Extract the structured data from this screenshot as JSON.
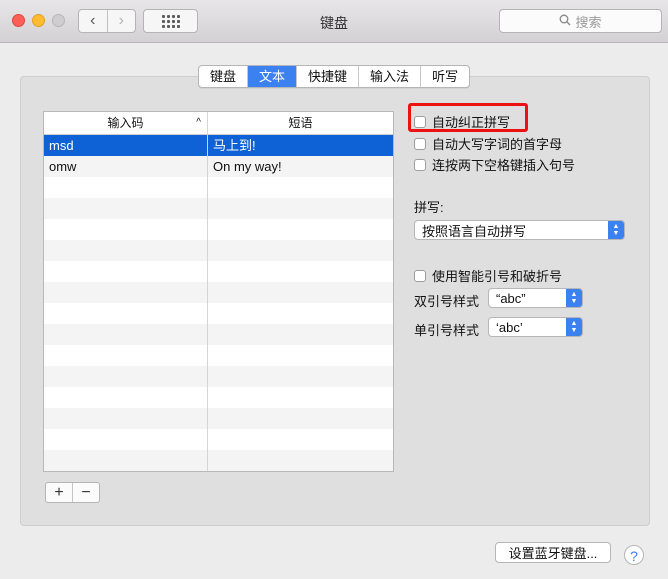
{
  "window": {
    "title": "键盘",
    "search_placeholder": "搜索",
    "nav_back_icon": "chevron-left-icon",
    "nav_forward_icon": "chevron-right-icon"
  },
  "tabs": [
    {
      "label": "键盘",
      "active": false
    },
    {
      "label": "文本",
      "active": true
    },
    {
      "label": "快捷键",
      "active": false
    },
    {
      "label": "输入法",
      "active": false
    },
    {
      "label": "听写",
      "active": false
    }
  ],
  "table": {
    "col1_header": "输入码",
    "col2_header": "短语",
    "sort_indicator": "^",
    "rows": [
      {
        "code": "msd",
        "phrase": "马上到!",
        "selected": true
      },
      {
        "code": "omw",
        "phrase": "On my way!",
        "selected": false
      }
    ],
    "add_label": "+",
    "remove_label": "−"
  },
  "options": {
    "autocorrect": {
      "label": "自动纠正拼写",
      "checked": false
    },
    "capitalize": {
      "label": "自动大写字词的首字母",
      "checked": false
    },
    "double_space": {
      "label": "连按两下空格键插入句号",
      "checked": false
    },
    "spelling_label": "拼写:",
    "spelling_value": "按照语言自动拼写",
    "smart_quotes": {
      "label": "使用智能引号和破折号",
      "checked": false
    },
    "double_quote_label": "双引号样式",
    "double_quote_value": "“abc”",
    "single_quote_label": "单引号样式",
    "single_quote_value": "‘abc’"
  },
  "bottom": {
    "bluetooth_button": "设置蓝牙键盘...",
    "help_label": "?"
  },
  "colors": {
    "accent": "#3b82f0",
    "selection": "#0f62d6",
    "highlight": "#ee1111"
  }
}
